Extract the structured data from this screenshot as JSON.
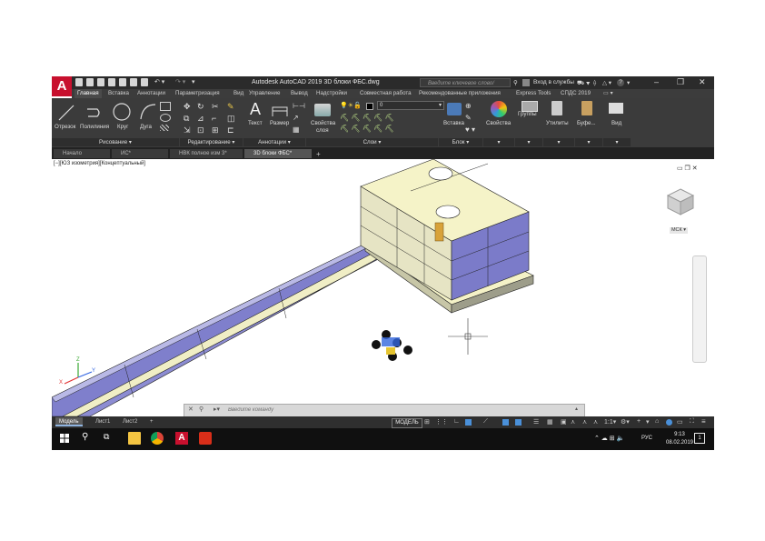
{
  "window": {
    "title": "Autodesk AutoCAD 2019   3D блоки ФБС.dwg",
    "search_placeholder": "Введите ключевое слово/фразу",
    "signin": "Вход в службы",
    "minimize": "–",
    "restore": "❐",
    "close": "✕"
  },
  "ribbon_tabs": [
    "Главная",
    "Вставка",
    "Аннотации",
    "Параметризация",
    "Вид",
    "Управление",
    "Вывод",
    "Надстройки",
    "Совместная работа",
    "Рекомендованные приложения",
    "Express Tools",
    "СПДС 2019"
  ],
  "ribbon": {
    "draw": {
      "line": "Отрезок",
      "polyline": "Полилиния",
      "circle": "Круг",
      "arc": "Дуга",
      "group": "Рисование ▾"
    },
    "modify": {
      "group": "Редактирование ▾"
    },
    "annotation": {
      "text": "Текст",
      "dimension": "Размер",
      "group": "Аннотации ▾"
    },
    "layers": {
      "properties": "Свойства",
      "properties2": "слоя",
      "layer_value": "0",
      "group": "Слои ▾"
    },
    "block": {
      "insert": "Вставка",
      "group": "Блок ▾"
    },
    "properties": {
      "label": "Свойства"
    },
    "groups": {
      "label": "Группы"
    },
    "utilities": {
      "label": "Утилиты"
    },
    "clipboard": {
      "label": "Буфе..."
    },
    "view": {
      "label": "Вид"
    }
  },
  "doc_tabs": [
    "Начало",
    "ИС*",
    "НВК полное изм 3*",
    "3D блоки ФБС*"
  ],
  "viewport": {
    "label": "[−][ЮЗ изометрия][Концептуальный]",
    "viewcube_label": "МСК ▾"
  },
  "command": {
    "placeholder": "Введите команду"
  },
  "layout_tabs": [
    "Модель",
    "Лист1",
    "Лист2"
  ],
  "status": {
    "model": "МОДЕЛЬ"
  },
  "taskbar": {
    "lang": "РУС",
    "time": "9:13",
    "date": "08.02.2019",
    "notify": "1"
  },
  "colors": {
    "ribbon": "#3b3b3b",
    "titlebar": "#2b2b2b",
    "accent": "#c8102e",
    "block_top": "#f4f2c7",
    "block_side": "#7777c8",
    "block_face": "#e4e2c0"
  }
}
